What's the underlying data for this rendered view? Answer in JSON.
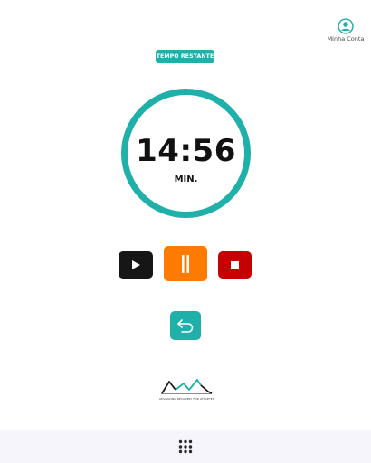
{
  "account": {
    "label": "Minha Conta",
    "icon": "user-circle-icon"
  },
  "timer": {
    "badge": "TEMPO RESTANTE",
    "time": "14:56",
    "unit": "MIN."
  },
  "controls": {
    "play_icon": "play-icon",
    "pause_icon": "pause-icon",
    "stop_icon": "stop-icon",
    "back_icon": "undo-arrow-icon"
  },
  "logo": {
    "tagline": "ADVANCING RECOVERY FOR ATHLETES"
  },
  "bottom_bar": {
    "icon": "apps-grid-icon"
  },
  "colors": {
    "accent": "#1fb0aa",
    "play": "#161616",
    "pause": "#ff7a00",
    "stop": "#c60000"
  }
}
